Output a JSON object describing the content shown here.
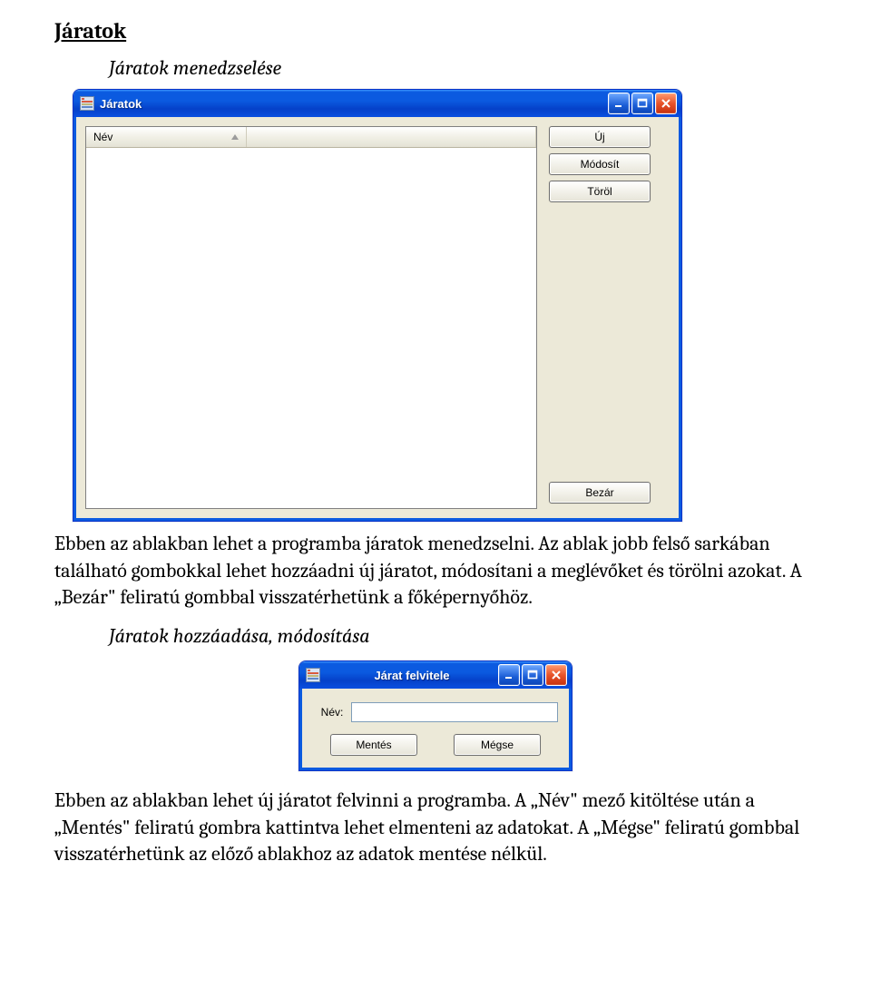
{
  "doc": {
    "heading": "Járatok",
    "sub1": "Járatok menedzselése",
    "para1": "Ebben az ablakban lehet a programba járatok menedzselni. Az ablak jobb felső sarkában található gombokkal lehet hozzáadni új járatot, módosítani a meglévőket és törölni azokat. A „Bezár\" feliratú gombbal visszatérhetünk a főképernyőhöz.",
    "sub2": "Járatok hozzáadása, módosítása",
    "para2": "Ebben az ablakban lehet új járatot felvinni a programba. A „Név\" mező kitöltése után a „Mentés\" feliratú gombra kattintva lehet elmenteni az adatokat. A „Mégse\" feliratú gombbal visszatérhetünk az előző ablakhoz az adatok mentése nélkül."
  },
  "windows": {
    "jaratok": {
      "title": "Járatok",
      "grid": {
        "columns": [
          "Név"
        ]
      },
      "buttons": {
        "new": "Új",
        "modify": "Módosít",
        "delete": "Töröl",
        "close": "Bezár"
      }
    },
    "felvitel": {
      "title": "Járat felvitele",
      "label_name": "Név:",
      "input_value": "",
      "btn_save": "Mentés",
      "btn_cancel": "Mégse"
    }
  }
}
